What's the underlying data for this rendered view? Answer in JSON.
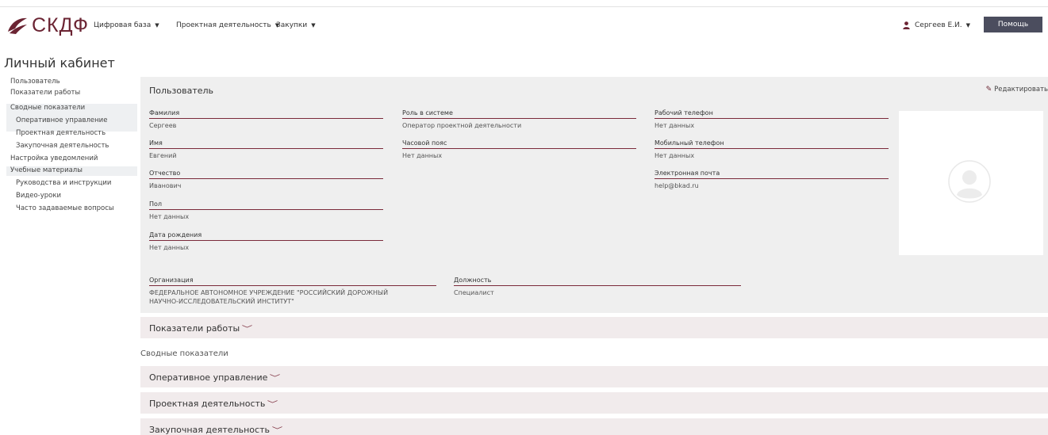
{
  "header": {
    "logo_text": "СКДФ",
    "nav": [
      {
        "label": "Цифровая база",
        "caret": "▼"
      },
      {
        "label": "Проектная деятельность",
        "caret": "▼"
      },
      {
        "label": "Закупки",
        "caret": "▼"
      }
    ],
    "user_name": "Сергеев Е.И.",
    "user_caret": "▼",
    "help_label": "Помощь",
    "brand_color": "#6b2433"
  },
  "page_title": "Личный кабинет",
  "sidebar": {
    "items": [
      {
        "label": "Пользователь"
      },
      {
        "label": "Показатели работы"
      },
      {
        "label": "Сводные показатели"
      },
      {
        "label": "Оперативное управление"
      },
      {
        "label": "Проектная деятельность"
      },
      {
        "label": "Закупочная деятельность"
      },
      {
        "label": "Настройка уведомлений"
      },
      {
        "label": "Учебные материалы"
      },
      {
        "label": "Руководства и инструкции"
      },
      {
        "label": "Видео-уроки"
      },
      {
        "label": "Часто задаваемые вопросы"
      }
    ]
  },
  "user_panel": {
    "title": "Пользователь",
    "edit_label": "Редактировать",
    "fields": {
      "surname": {
        "label": "Фамилия",
        "value": "Сергеев"
      },
      "name": {
        "label": "Имя",
        "value": "Евгений"
      },
      "patronymic": {
        "label": "Отчество",
        "value": "Иванович"
      },
      "gender": {
        "label": "Пол",
        "value": "Нет данных"
      },
      "birthdate": {
        "label": "Дата рождения",
        "value": "Нет данных"
      },
      "role": {
        "label": "Роль в системе",
        "value": "Оператор проектной деятельности"
      },
      "timezone": {
        "label": "Часовой пояс",
        "value": "Нет данных"
      },
      "work_phone": {
        "label": "Рабочий телефон",
        "value": "Нет данных"
      },
      "mobile_phone": {
        "label": "Мобильный телефон",
        "value": "Нет данных"
      },
      "email": {
        "label": "Электронная почта",
        "value": "help@bkad.ru"
      },
      "organization": {
        "label": "Организация",
        "value": "ФЕДЕРАЛЬНОЕ АВТОНОМНОЕ УЧРЕЖДЕНИЕ \"РОССИЙСКИЙ ДОРОЖНЫЙ НАУЧНО-ИССЛЕДОВАТЕЛЬСКИЙ ИНСТИТУТ\""
      },
      "position": {
        "label": "Должность",
        "value": "Специалист"
      }
    }
  },
  "accordions": {
    "work_metrics": "Показатели работы",
    "summary_heading": "Сводные показатели",
    "operational": "Оперативное управление",
    "project": "Проектная деятельность",
    "procurement": "Закупочная деятельность",
    "chevron": "﹀"
  }
}
